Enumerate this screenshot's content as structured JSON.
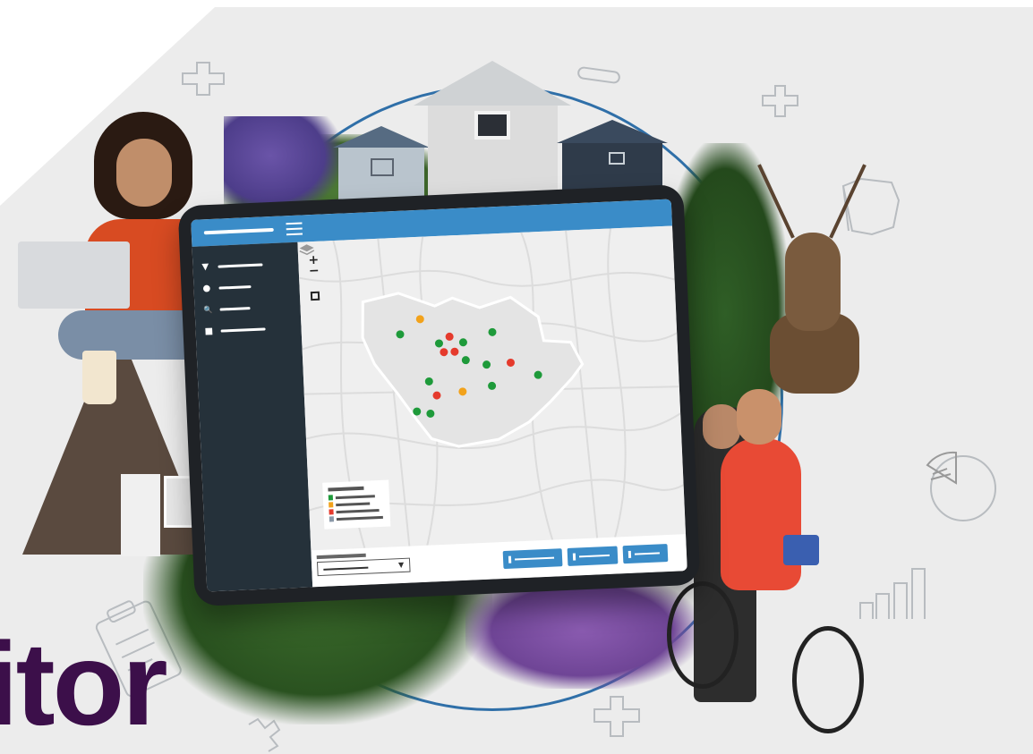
{
  "brand": {
    "visible_text": "itor",
    "color": "#3c0f4a"
  },
  "colors": {
    "accent": "#3a8cc8",
    "sidebar": "#25313a",
    "circle": "#2f6fa8",
    "marker_good": "#1e9a3a",
    "marker_warn": "#f2a21b",
    "marker_bad": "#e53a2c"
  },
  "app": {
    "topbar": {
      "logo": "app-logo-bar",
      "menu_icon": "hamburger-menu-icon"
    },
    "sidebar": {
      "items": [
        {
          "icon": "map-pin-icon",
          "glyph": "▼"
        },
        {
          "icon": "dot-icon",
          "glyph": "●"
        },
        {
          "icon": "search-icon",
          "glyph": "🔍"
        },
        {
          "icon": "tag-icon",
          "glyph": "■"
        }
      ]
    },
    "map": {
      "zoom_in": "+",
      "zoom_out": "−",
      "markers_status": [
        "warn",
        "good",
        "good",
        "bad",
        "good",
        "good",
        "bad",
        "bad",
        "good",
        "good",
        "bad",
        "good",
        "good",
        "warn",
        "good",
        "bad",
        "good",
        "good"
      ]
    },
    "legend": {
      "categories": [
        "good",
        "warn",
        "bad",
        "neutral"
      ]
    },
    "footer": {
      "dropdown_arrow": "▼",
      "buttons": 3
    }
  },
  "decorations": [
    "plus-doodle-icon",
    "minus-doodle-icon",
    "plus-doodle-icon",
    "thumbs-up-doodle-icon",
    "pie-chart-doodle-icon",
    "bar-chart-doodle-icon",
    "clipboard-doodle-icon",
    "plus-doodle-icon",
    "cross-doodle-icon"
  ]
}
